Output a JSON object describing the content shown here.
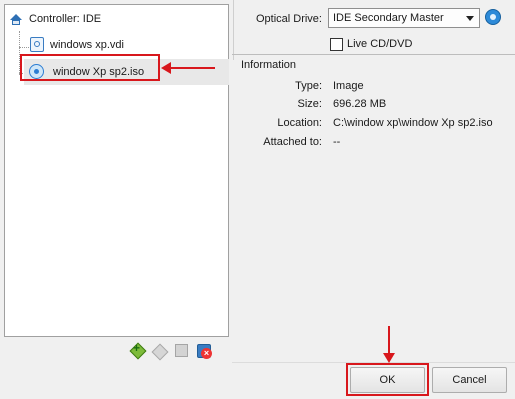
{
  "tree": {
    "controller_label": "Controller: IDE",
    "items": [
      {
        "label": "windows xp.vdi",
        "icon": "hard-disk-icon"
      },
      {
        "label": "window Xp sp2.iso",
        "icon": "optical-disc-icon",
        "selected": true
      }
    ]
  },
  "toolbar": {
    "icons": [
      "add-controller-icon",
      "add-hard-disk-icon",
      "add-floppy-icon",
      "remove-attachment-icon"
    ]
  },
  "attributes": {
    "optical_drive_label": "Optical Drive:",
    "optical_drive_value": "IDE Secondary Master",
    "live_cd_label": "Live CD/DVD",
    "live_cd_checked": false
  },
  "information": {
    "heading": "Information",
    "rows": [
      {
        "key": "Type:",
        "value": "Image"
      },
      {
        "key": "Size:",
        "value": "696.28 MB"
      },
      {
        "key": "Location:",
        "value": "C:\\window xp\\window Xp sp2.iso"
      },
      {
        "key": "Attached to:",
        "value": "--"
      }
    ]
  },
  "buttons": {
    "ok": "OK",
    "cancel": "Cancel"
  },
  "colors": {
    "annotation_red": "#d8171c",
    "selection_bg": "#e8e8e8"
  }
}
